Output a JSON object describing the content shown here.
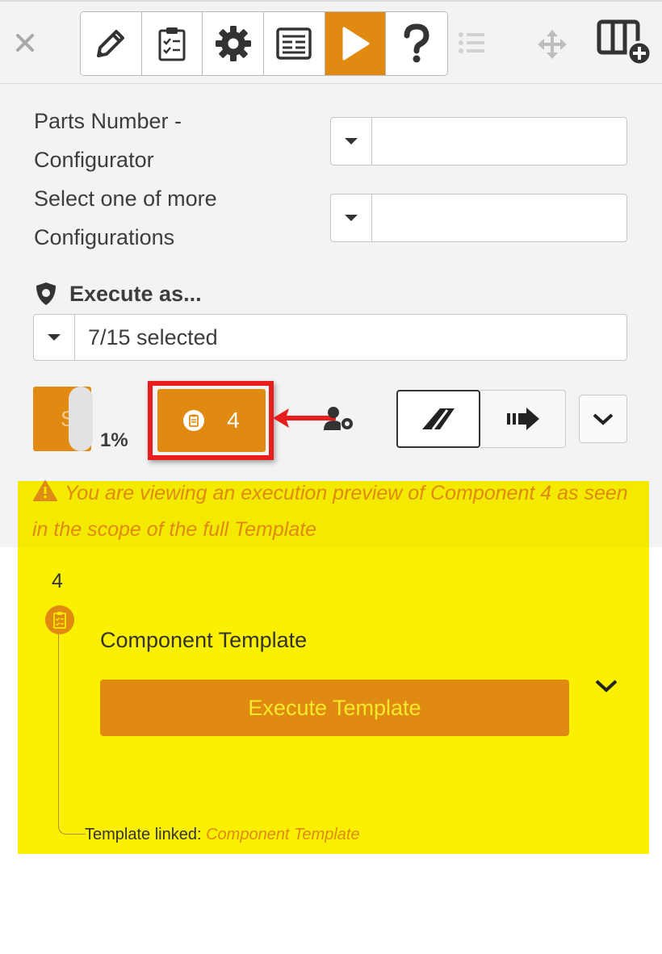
{
  "toolbar": {
    "buttons": [
      {
        "name": "edit",
        "icon": "pencil-icon"
      },
      {
        "name": "checklist",
        "icon": "clipboard-checklist-icon"
      },
      {
        "name": "settings",
        "icon": "gear-icon"
      },
      {
        "name": "form",
        "icon": "form-icon"
      },
      {
        "name": "run",
        "icon": "play-icon",
        "active": true
      },
      {
        "name": "help",
        "icon": "question-icon"
      }
    ],
    "extra_icons": [
      "list-icon",
      "move-icon",
      "add-layout-icon"
    ]
  },
  "form": {
    "field1_label": "Parts Number - Configurator",
    "field1_value": "",
    "field2_label": "Select one of more Configurations",
    "field2_value": ""
  },
  "execute_as": {
    "heading": "Execute as...",
    "value": "7/15 selected"
  },
  "actions": {
    "start_label": "Start",
    "progress_label": "1%",
    "component_count": "4"
  },
  "warning": {
    "text": "You are viewing an execution preview of Component 4 as seen in the scope of the full Template"
  },
  "timeline": {
    "step_number": "4",
    "component_title": "Component Template",
    "execute_button": "Execute Template",
    "linked_prefix": "Template linked:",
    "linked_name": "Component Template"
  },
  "colors": {
    "accent": "#e08a12",
    "highlight": "#fbf000",
    "arrow": "#e81e1e"
  }
}
